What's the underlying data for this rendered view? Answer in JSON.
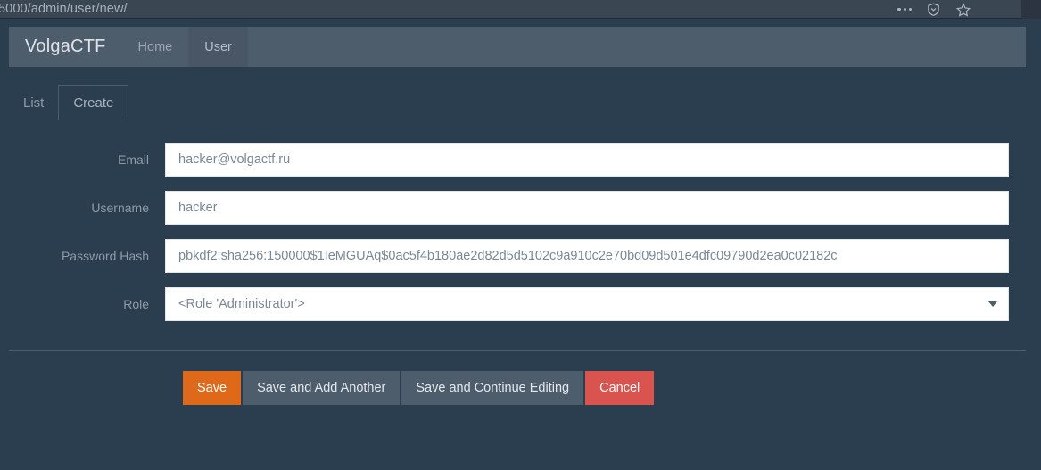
{
  "browser": {
    "url": "5000/admin/user/new/",
    "icons": [
      {
        "name": "more-menu-icon",
        "glyph": "•••"
      },
      {
        "name": "tracking-protection-shield-icon",
        "glyph": "⛉"
      },
      {
        "name": "bookmark-star-icon",
        "glyph": "☆"
      }
    ]
  },
  "navbar": {
    "brand": "VolgaCTF",
    "items": [
      {
        "label": "Home",
        "active": false
      },
      {
        "label": "User",
        "active": true
      }
    ]
  },
  "tabs": [
    {
      "label": "List",
      "active": false
    },
    {
      "label": "Create",
      "active": true
    }
  ],
  "form": {
    "fields": [
      {
        "label": "Email",
        "value": "hacker@volgactf.ru",
        "type": "text"
      },
      {
        "label": "Username",
        "value": "hacker",
        "type": "text"
      },
      {
        "label": "Password Hash",
        "value": "pbkdf2:sha256:150000$1IeMGUAq$0ac5f4b180ae2d82d5d5102c9a910c2e70bd09d501e4dfc09790d2ea0c02182c",
        "type": "text"
      },
      {
        "label": "Role",
        "value": "<Role 'Administrator'>",
        "type": "select"
      }
    ]
  },
  "buttons": [
    {
      "label": "Save",
      "style": "save"
    },
    {
      "label": "Save and Add Another",
      "style": "default"
    },
    {
      "label": "Save and Continue Editing",
      "style": "default"
    },
    {
      "label": "Cancel",
      "style": "cancel"
    }
  ],
  "colors": {
    "page_background": "#2b3e50",
    "navbar": "#4e5d6c",
    "accent_orange": "#df691a",
    "danger_red": "#d9534f",
    "browser_bar": "#3b4653",
    "input_background": "#ffffff",
    "label_text": "#8f9aa6"
  }
}
